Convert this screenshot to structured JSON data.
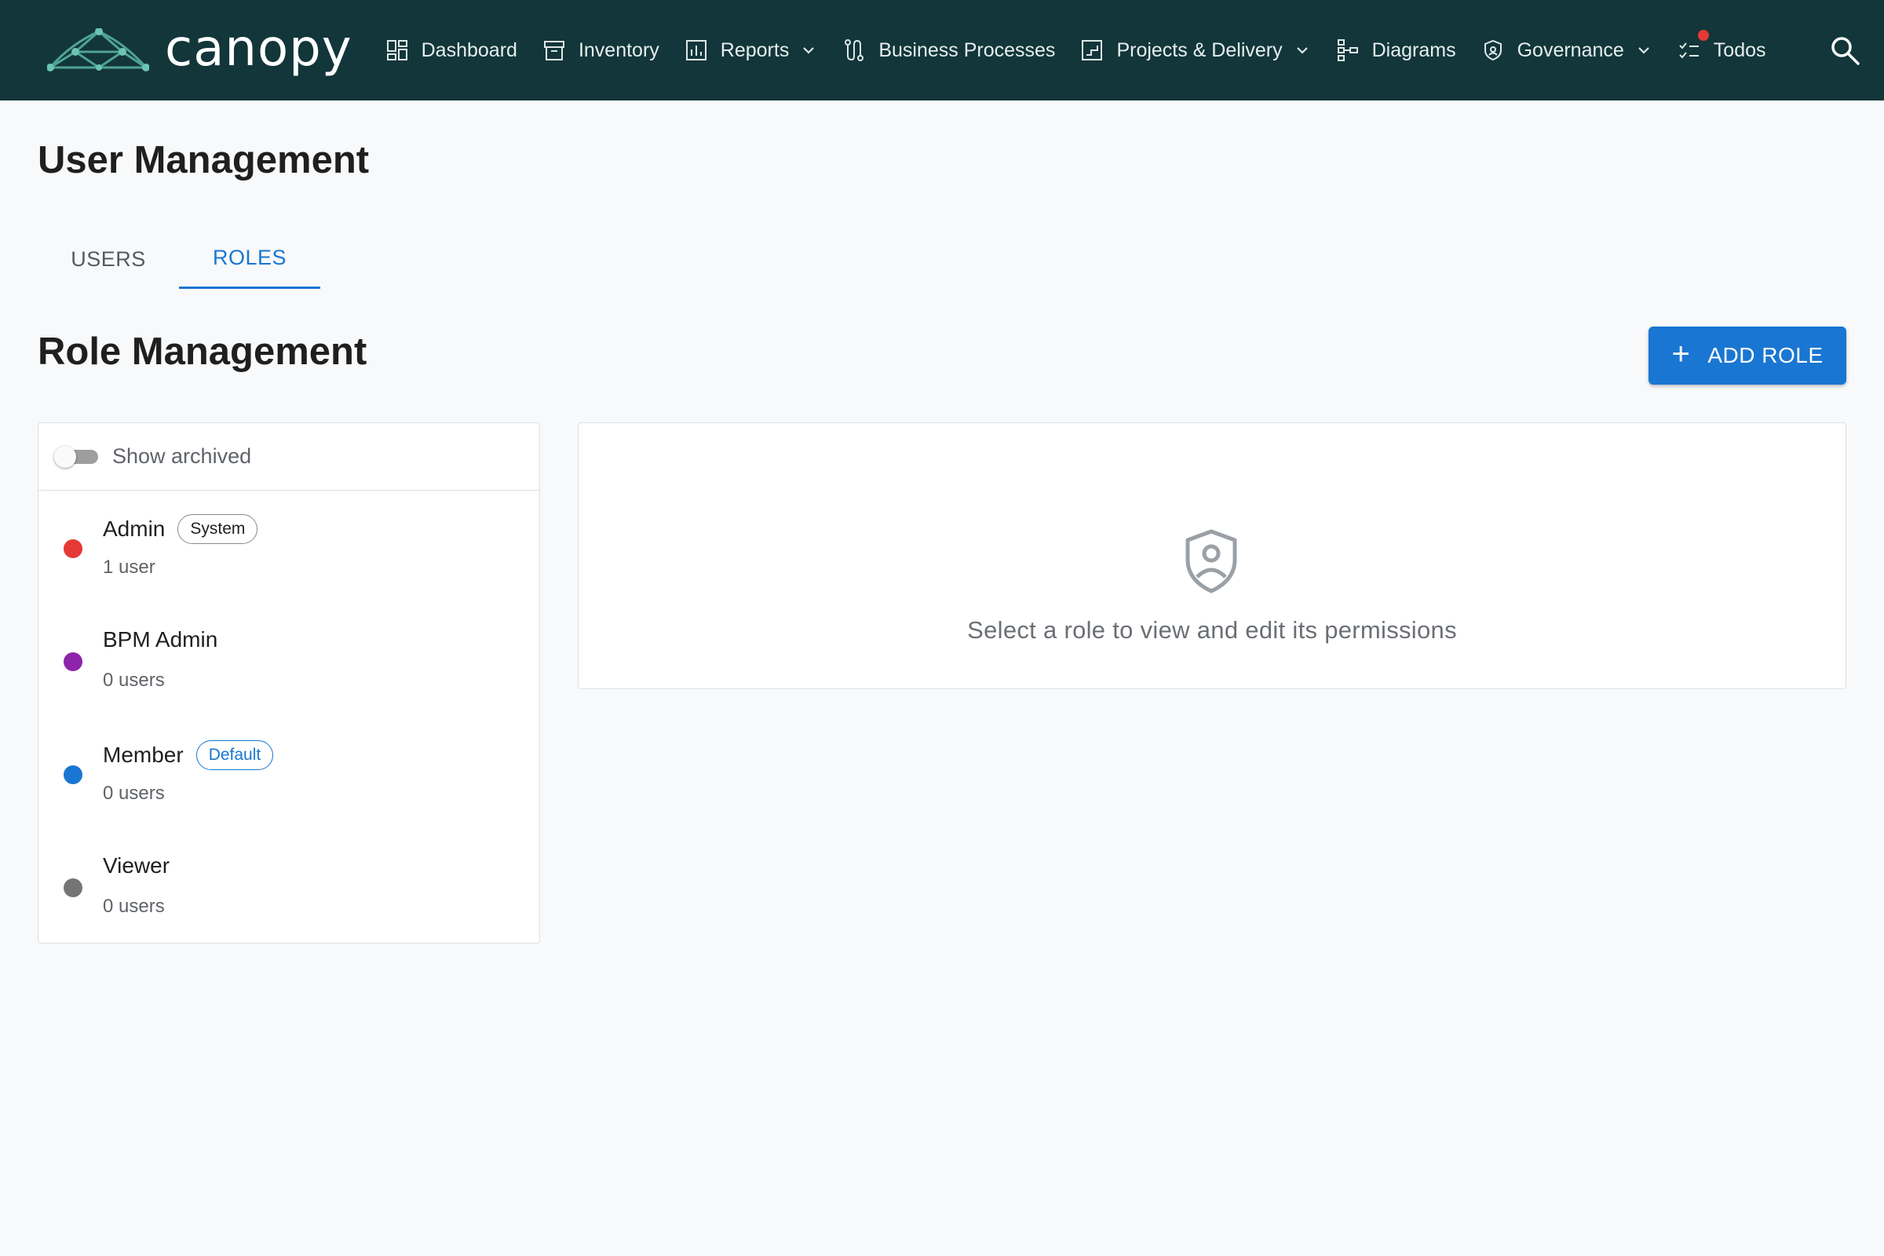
{
  "app": {
    "name": "canopy"
  },
  "nav": [
    {
      "label": "Dashboard",
      "icon": "dashboard-icon",
      "dropdown": false
    },
    {
      "label": "Inventory",
      "icon": "archive-box-icon",
      "dropdown": false
    },
    {
      "label": "Reports",
      "icon": "bar-chart-icon",
      "dropdown": true
    },
    {
      "label": "Business Processes",
      "icon": "process-flow-icon",
      "dropdown": false
    },
    {
      "label": "Projects & Delivery",
      "icon": "project-chart-icon",
      "dropdown": true
    },
    {
      "label": "Diagrams",
      "icon": "hierarchy-icon",
      "dropdown": false
    },
    {
      "label": "Governance",
      "icon": "shield-icon",
      "dropdown": true
    },
    {
      "label": "Todos",
      "icon": "checklist-icon",
      "dropdown": false,
      "has_notification": true
    }
  ],
  "page": {
    "title": "User Management"
  },
  "tabs": [
    {
      "label": "USERS",
      "active": false
    },
    {
      "label": "ROLES",
      "active": true
    }
  ],
  "roles_section": {
    "title": "Role Management",
    "add_button": "ADD ROLE",
    "show_archived_label": "Show archived",
    "show_archived": false
  },
  "roles": [
    {
      "name": "Admin",
      "badge": "System",
      "badge_type": "system",
      "count": "1 user",
      "color": "#e53935"
    },
    {
      "name": "BPM Admin",
      "badge": "",
      "badge_type": "",
      "count": "0 users",
      "color": "#8e24aa"
    },
    {
      "name": "Member",
      "badge": "Default",
      "badge_type": "default",
      "count": "0 users",
      "color": "#1976d2"
    },
    {
      "name": "Viewer",
      "badge": "",
      "badge_type": "",
      "count": "0 users",
      "color": "#757575"
    }
  ],
  "detail": {
    "empty_message": "Select a role to view and edit its permissions"
  },
  "colors": {
    "topbar": "#12363a",
    "accent": "#1976d2"
  }
}
